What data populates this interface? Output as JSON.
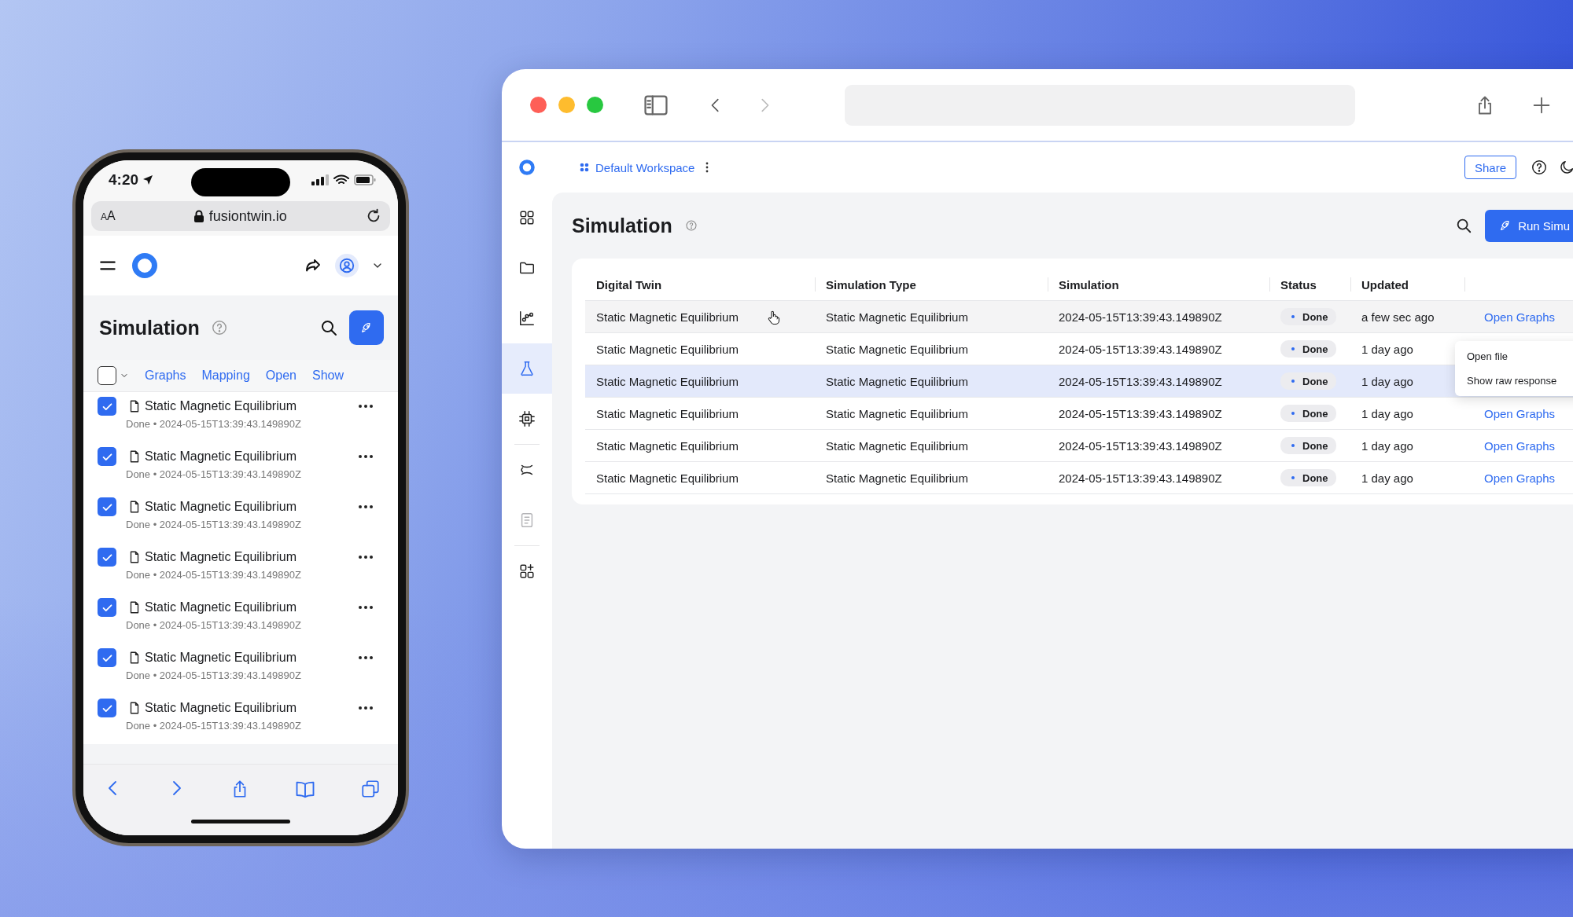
{
  "phone": {
    "status_bar": {
      "time": "4:20"
    },
    "address_bar": {
      "text_size": "AA",
      "url": "fusiontwin.io"
    },
    "page": {
      "title": "Simulation",
      "select_all_checked": false,
      "actions": [
        "Graphs",
        "Mapping",
        "Open",
        "Show"
      ],
      "items": [
        {
          "name": "Static Magnetic Equilibrium",
          "detail": "Done • 2024-05-15T13:39:43.149890Z",
          "checked": true
        },
        {
          "name": "Static Magnetic Equilibrium",
          "detail": "Done • 2024-05-15T13:39:43.149890Z",
          "checked": true
        },
        {
          "name": "Static Magnetic Equilibrium",
          "detail": "Done • 2024-05-15T13:39:43.149890Z",
          "checked": true
        },
        {
          "name": "Static Magnetic Equilibrium",
          "detail": "Done • 2024-05-15T13:39:43.149890Z",
          "checked": true
        },
        {
          "name": "Static Magnetic Equilibrium",
          "detail": "Done • 2024-05-15T13:39:43.149890Z",
          "checked": true
        },
        {
          "name": "Static Magnetic Equilibrium",
          "detail": "Done • 2024-05-15T13:39:43.149890Z",
          "checked": true
        },
        {
          "name": "Static Magnetic Equilibrium",
          "detail": "Done • 2024-05-15T13:39:43.149890Z",
          "checked": true
        }
      ]
    }
  },
  "browser": {
    "toolbar": {
      "back_disabled": false,
      "forward_disabled": true
    },
    "app": {
      "workspace": "Default Workspace",
      "share": "Share",
      "sidebar_groups": [
        {
          "items": [
            {
              "kind": "apps",
              "selected": false,
              "disabled": false
            },
            {
              "kind": "folder",
              "selected": false,
              "disabled": false
            },
            {
              "kind": "chart",
              "selected": false,
              "disabled": false
            },
            {
              "kind": "flask",
              "selected": true,
              "disabled": false
            },
            {
              "kind": "chip",
              "selected": false,
              "disabled": false
            }
          ]
        },
        {
          "items": [
            {
              "kind": "orbit",
              "selected": false,
              "disabled": false
            },
            {
              "kind": "document",
              "selected": false,
              "disabled": true
            }
          ]
        },
        {
          "items": [
            {
              "kind": "add-apps",
              "selected": false,
              "disabled": false
            }
          ]
        }
      ],
      "title": "Simulation",
      "run_button": "Run Simu",
      "table": {
        "columns": [
          "Digital Twin",
          "Simulation Type",
          "Simulation",
          "Status",
          "Updated"
        ],
        "rows": [
          {
            "digital_twin": "Static Magnetic Equilibrium",
            "simulation_type": "Static Magnetic Equilibrium",
            "simulation": "2024-05-15T13:39:43.149890Z",
            "status": "Done",
            "updated": "a few sec ago",
            "action": "Open Graphs",
            "hovered": true,
            "selected": false
          },
          {
            "digital_twin": "Static Magnetic Equilibrium",
            "simulation_type": "Static Magnetic Equilibrium",
            "simulation": "2024-05-15T13:39:43.149890Z",
            "status": "Done",
            "updated": "1 day ago",
            "hovered": false,
            "selected": false
          },
          {
            "digital_twin": "Static Magnetic Equilibrium",
            "simulation_type": "Static Magnetic Equilibrium",
            "simulation": "2024-05-15T13:39:43.149890Z",
            "status": "Done",
            "updated": "1 day ago",
            "hovered": false,
            "selected": true
          },
          {
            "digital_twin": "Static Magnetic Equilibrium",
            "simulation_type": "Static Magnetic Equilibrium",
            "simulation": "2024-05-15T13:39:43.149890Z",
            "status": "Done",
            "updated": "1 day ago",
            "action": "Open Graphs",
            "hovered": false,
            "selected": false
          },
          {
            "digital_twin": "Static Magnetic Equilibrium",
            "simulation_type": "Static Magnetic Equilibrium",
            "simulation": "2024-05-15T13:39:43.149890Z",
            "status": "Done",
            "updated": "1 day ago",
            "action": "Open Graphs",
            "hovered": false,
            "selected": false
          },
          {
            "digital_twin": "Static Magnetic Equilibrium",
            "simulation_type": "Static Magnetic Equilibrium",
            "simulation": "2024-05-15T13:39:43.149890Z",
            "status": "Done",
            "updated": "1 day ago",
            "action": "Open Graphs",
            "hovered": false,
            "selected": false
          }
        ]
      },
      "context_menu": [
        "Open file",
        "Show raw response"
      ]
    }
  }
}
